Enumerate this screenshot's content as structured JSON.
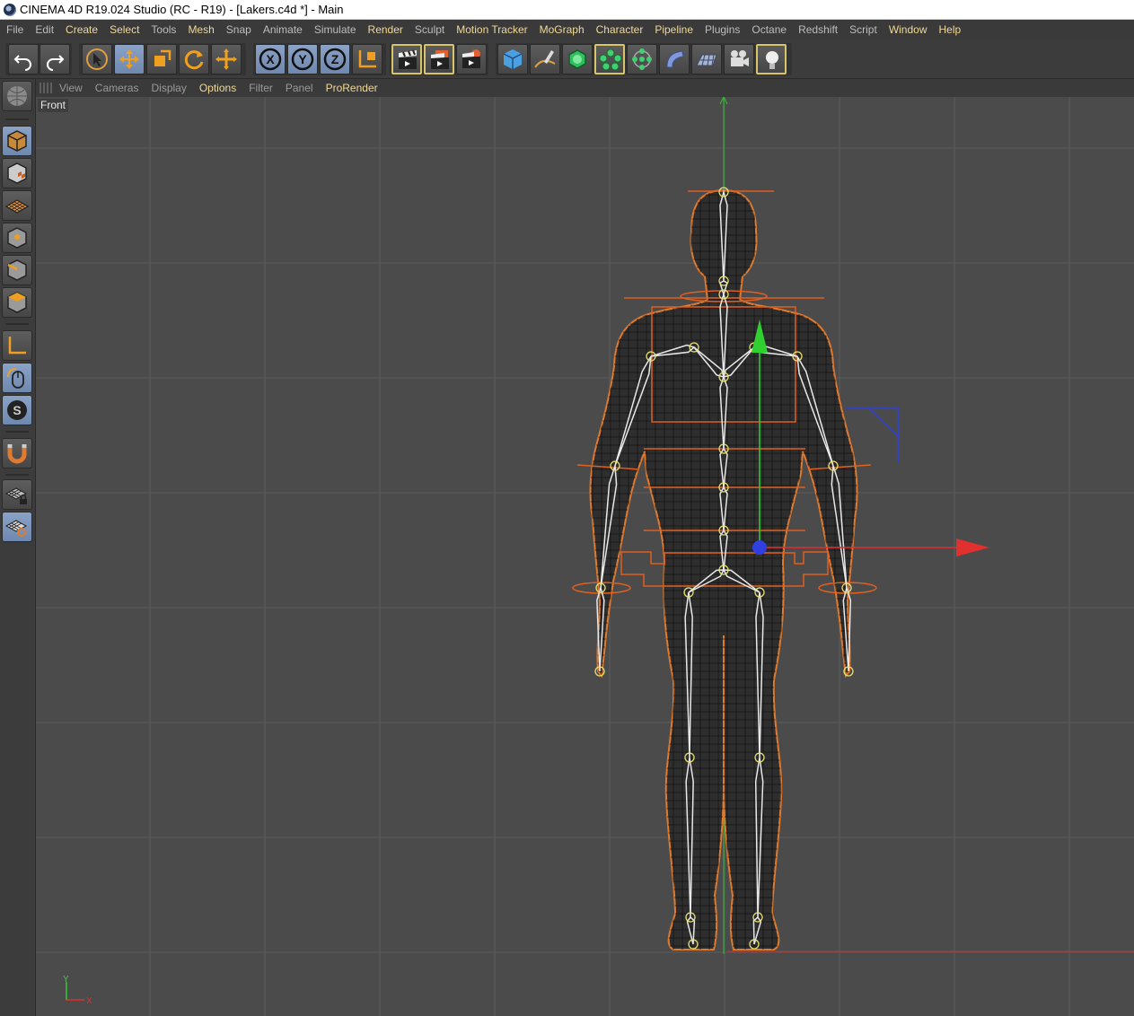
{
  "window": {
    "title": "CINEMA 4D R19.024 Studio (RC - R19) - [Lakers.c4d *] - Main"
  },
  "menu": [
    {
      "label": "File",
      "highlight": false
    },
    {
      "label": "Edit",
      "highlight": false
    },
    {
      "label": "Create",
      "highlight": true
    },
    {
      "label": "Select",
      "highlight": true
    },
    {
      "label": "Tools",
      "highlight": false
    },
    {
      "label": "Mesh",
      "highlight": true
    },
    {
      "label": "Snap",
      "highlight": false
    },
    {
      "label": "Animate",
      "highlight": false
    },
    {
      "label": "Simulate",
      "highlight": false
    },
    {
      "label": "Render",
      "highlight": true
    },
    {
      "label": "Sculpt",
      "highlight": false
    },
    {
      "label": "Motion Tracker",
      "highlight": true
    },
    {
      "label": "MoGraph",
      "highlight": true
    },
    {
      "label": "Character",
      "highlight": true
    },
    {
      "label": "Pipeline",
      "highlight": true
    },
    {
      "label": "Plugins",
      "highlight": false
    },
    {
      "label": "Octane",
      "highlight": false
    },
    {
      "label": "Redshift",
      "highlight": false
    },
    {
      "label": "Script",
      "highlight": false
    },
    {
      "label": "Window",
      "highlight": true
    },
    {
      "label": "Help",
      "highlight": true
    }
  ],
  "viewport_menu": [
    {
      "label": "View",
      "highlight": false
    },
    {
      "label": "Cameras",
      "highlight": false
    },
    {
      "label": "Display",
      "highlight": false
    },
    {
      "label": "Options",
      "highlight": true
    },
    {
      "label": "Filter",
      "highlight": false
    },
    {
      "label": "Panel",
      "highlight": false
    },
    {
      "label": "ProRender",
      "highlight": true
    }
  ],
  "viewport": {
    "label": "Front"
  },
  "axis_indicator": {
    "y": "Y",
    "x": "X"
  },
  "colors": {
    "accent_orange": "#e07a2e",
    "bone": "#e8e8e8",
    "joint": "#e8e070",
    "axis_x": "#e03030",
    "axis_y": "#30d030",
    "axis_z": "#2f3fe0",
    "grid": "#5c5c5c",
    "viewport_bg": "#4b4b4b",
    "menu_highlight": "#f0d896"
  }
}
